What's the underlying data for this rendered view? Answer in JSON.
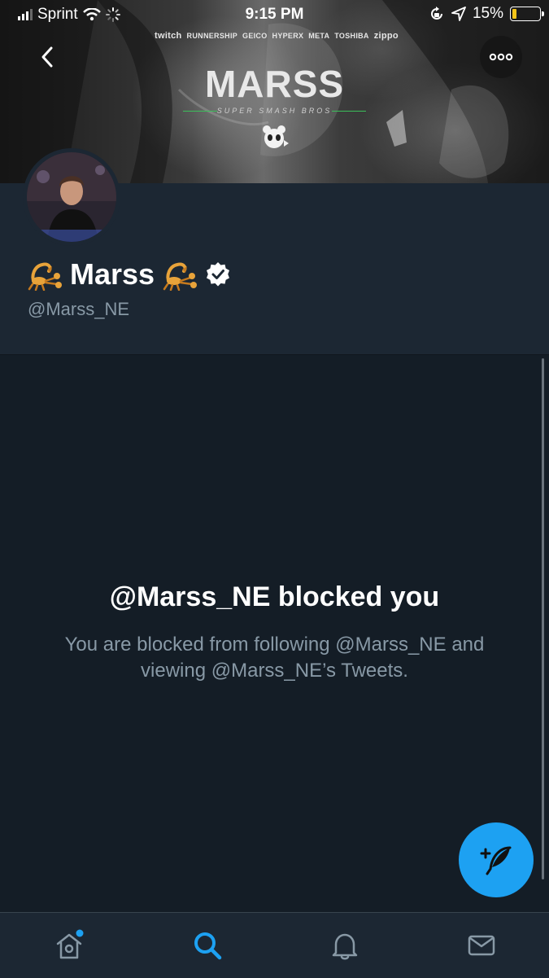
{
  "status_bar": {
    "carrier": "Sprint",
    "time": "9:15 PM",
    "battery_percent": "15%",
    "battery_level": 0.15,
    "battery_color": "#f5c518",
    "signal_bars": 3
  },
  "banner": {
    "title": "MARSS",
    "subtitle": "SUPER SMASH BROS",
    "sponsors": [
      "twitch",
      "RUNNERSHIP",
      "GEICO",
      "HYPERX",
      "META",
      "TOSHIBA",
      "zippo"
    ]
  },
  "nav": {
    "back_icon": "chevron-left-icon",
    "more_icon": "more-horizontal-icon"
  },
  "profile": {
    "name": "Marss",
    "name_emoji": "scorpion-emoji",
    "verified": true,
    "handle": "@Marss_NE"
  },
  "blocked": {
    "title": "@Marss_NE blocked you",
    "message": "You are blocked from following @Marss_NE and viewing @Marss_NE’s Tweets."
  },
  "fab": {
    "icon": "compose-tweet-icon",
    "color": "#1da1f2"
  },
  "tabbar": {
    "items": [
      {
        "name": "home",
        "icon": "home-icon",
        "active": false,
        "badge": true
      },
      {
        "name": "search",
        "icon": "search-icon",
        "active": true,
        "badge": false
      },
      {
        "name": "notifications",
        "icon": "bell-icon",
        "active": false,
        "badge": false
      },
      {
        "name": "messages",
        "icon": "mail-icon",
        "active": false,
        "badge": false
      }
    ],
    "accent_color": "#1da1f2"
  }
}
